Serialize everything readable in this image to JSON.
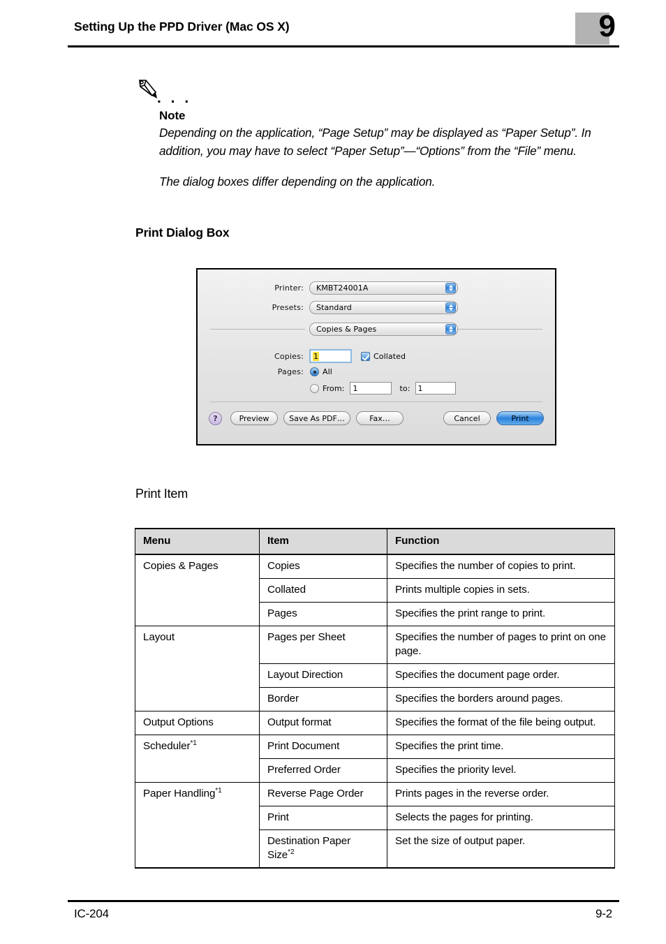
{
  "header": {
    "title": "Setting Up the PPD Driver (Mac OS X)",
    "chapter_number": "9"
  },
  "note": {
    "icon": "pencil-icon",
    "dots": ". . .",
    "heading": "Note",
    "paragraph1": "Depending on the application, “Page Setup” may be displayed as “Paper Setup”. In addition, you may have to select “Paper Setup”—“Options” from the “File” menu.",
    "paragraph2": "The dialog boxes differ depending on the application."
  },
  "sections": {
    "print_dialog_heading": "Print Dialog Box",
    "print_item_heading": "Print Item"
  },
  "print_dialog": {
    "printer_label": "Printer:",
    "printer_value": "KMBT24001A",
    "presets_label": "Presets:",
    "presets_value": "Standard",
    "pane_value": "Copies & Pages",
    "copies_label": "Copies:",
    "copies_value": "1",
    "collated_label": "Collated",
    "pages_label": "Pages:",
    "all_label": "All",
    "from_label": "From:",
    "from_value": "1",
    "to_label": "to:",
    "to_value": "1",
    "help_label": "?",
    "preview_label": "Preview",
    "save_as_pdf_label": "Save As PDF…",
    "fax_label": "Fax…",
    "cancel_label": "Cancel",
    "print_label": "Print",
    "colors": {
      "accent_blue": "#2d84dd",
      "selection_yellow": "#f5e03c",
      "help_purple": "#c9b8e0"
    }
  },
  "print_item_table": {
    "columns": [
      "Menu",
      "Item",
      "Function"
    ],
    "rows": [
      {
        "menu": "Copies & Pages",
        "menu_sup": "",
        "item": "Copies",
        "item_sup": "",
        "function": "Specifies the number of copies to print."
      },
      {
        "menu": "",
        "menu_sup": "",
        "item": "Collated",
        "item_sup": "",
        "function": "Prints multiple copies in sets."
      },
      {
        "menu": "",
        "menu_sup": "",
        "item": "Pages",
        "item_sup": "",
        "function": "Specifies the print range to print."
      },
      {
        "menu": "Layout",
        "menu_sup": "",
        "item": "Pages per Sheet",
        "item_sup": "",
        "function": "Specifies the number of pages to print on one page."
      },
      {
        "menu": "",
        "menu_sup": "",
        "item": "Layout Direction",
        "item_sup": "",
        "function": "Specifies the document page order."
      },
      {
        "menu": "",
        "menu_sup": "",
        "item": "Border",
        "item_sup": "",
        "function": "Specifies the borders around pages."
      },
      {
        "menu": "Output Options",
        "menu_sup": "",
        "item": "Output format",
        "item_sup": "",
        "function": "Specifies the format of the file being output."
      },
      {
        "menu": "Scheduler",
        "menu_sup": "*1",
        "item": "Print Document",
        "item_sup": "",
        "function": "Specifies the print time."
      },
      {
        "menu": "",
        "menu_sup": "",
        "item": "Preferred Order",
        "item_sup": "",
        "function": "Specifies the priority level."
      },
      {
        "menu": "Paper Handling",
        "menu_sup": "*1",
        "item": "Reverse Page Order",
        "item_sup": "",
        "function": "Prints pages in the reverse order."
      },
      {
        "menu": "",
        "menu_sup": "",
        "item": "Print",
        "item_sup": "",
        "function": "Selects the pages for printing."
      },
      {
        "menu": "",
        "menu_sup": "",
        "item": "Destination Paper Size",
        "item_sup": "*2",
        "function": "Set the size of output paper."
      }
    ]
  },
  "footer": {
    "left": "IC-204",
    "right": "9-2"
  }
}
